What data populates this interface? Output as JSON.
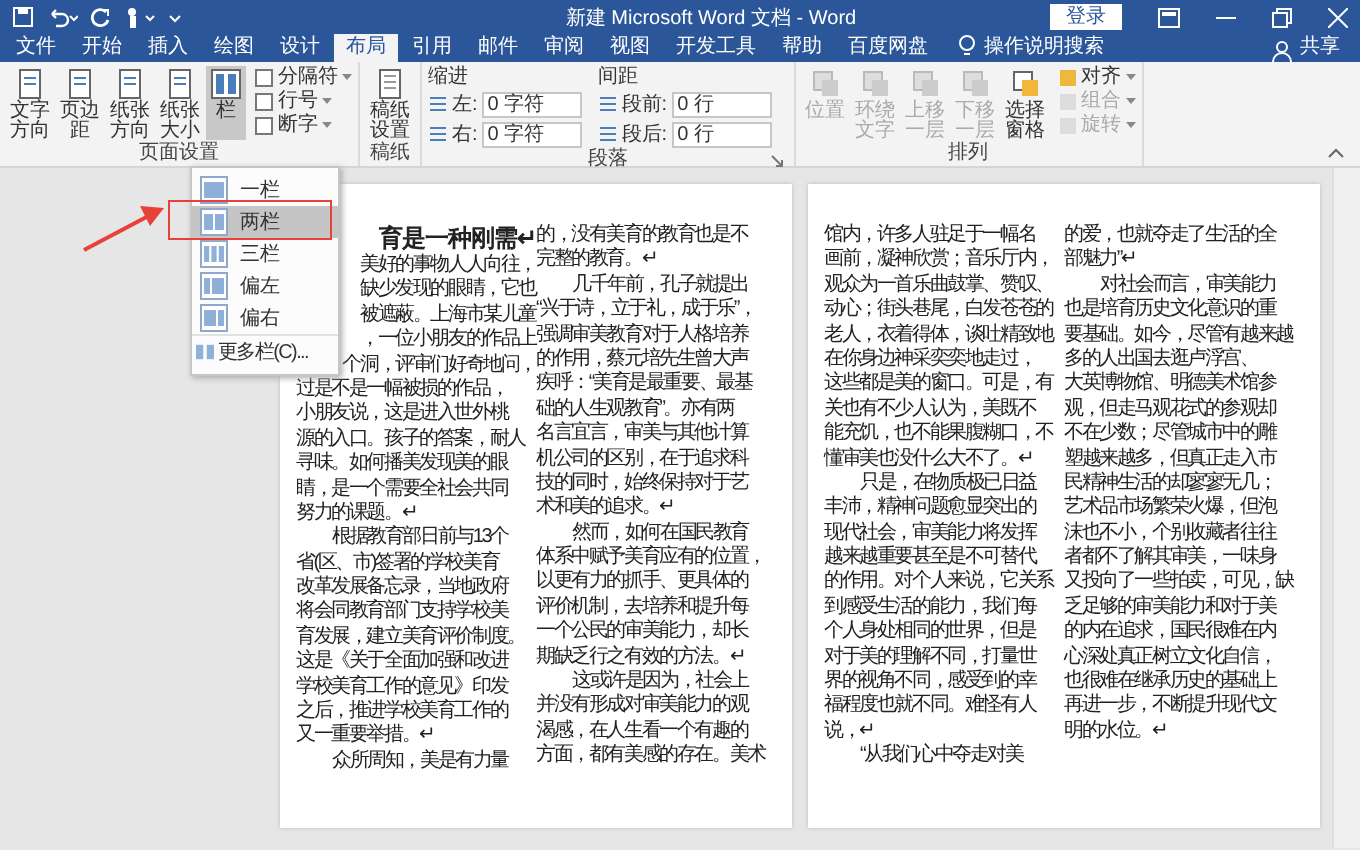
{
  "title_bar": {
    "title": "新建 Microsoft Word 文档 - Word",
    "sign_in": "登录"
  },
  "tabs": [
    {
      "label": "文件",
      "selected": false
    },
    {
      "label": "开始",
      "selected": false
    },
    {
      "label": "插入",
      "selected": false
    },
    {
      "label": "绘图",
      "selected": false
    },
    {
      "label": "设计",
      "selected": false
    },
    {
      "label": "布局",
      "selected": true
    },
    {
      "label": "引用",
      "selected": false
    },
    {
      "label": "邮件",
      "selected": false
    },
    {
      "label": "审阅",
      "selected": false
    },
    {
      "label": "视图",
      "selected": false
    },
    {
      "label": "开发工具",
      "selected": false
    },
    {
      "label": "帮助",
      "selected": false
    },
    {
      "label": "百度网盘",
      "selected": false
    }
  ],
  "tell_me": "操作说明搜索",
  "share": "共享",
  "page_setup": {
    "label": "页面设置",
    "large_buttons": [
      "文字方向",
      "页边距",
      "纸张方向",
      "纸张大小"
    ],
    "columns_button": {
      "label": "栏",
      "pressed": true
    },
    "small_buttons": [
      "分隔符",
      "行号",
      "断字"
    ]
  },
  "draft": {
    "label": "稿纸",
    "button": "稿纸设置"
  },
  "paragraph": {
    "label": "段落",
    "indent": {
      "title": "缩进",
      "fields": [
        {
          "label": "左:",
          "value": "0 字符"
        },
        {
          "label": "右:",
          "value": "0 字符"
        }
      ]
    },
    "spacing": {
      "title": "间距",
      "fields": [
        {
          "label": "段前:",
          "value": "0 行"
        },
        {
          "label": "段后:",
          "value": "0 行"
        }
      ]
    }
  },
  "arrange": {
    "label": "排列",
    "large_buttons": [
      {
        "label": "位置",
        "disabled": true
      },
      {
        "label": "环绕文字",
        "disabled": true
      },
      {
        "label": "上移一层",
        "disabled": true
      },
      {
        "label": "下移一层",
        "disabled": true
      },
      {
        "label": "选择窗格",
        "disabled": false
      }
    ],
    "small_buttons": [
      {
        "label": "对齐",
        "disabled": false
      },
      {
        "label": "组合",
        "disabled": true
      },
      {
        "label": "旋转",
        "disabled": true
      }
    ]
  },
  "columns_menu": {
    "items": [
      {
        "label": "一栏",
        "kind": "one",
        "selected": false
      },
      {
        "label": "两栏",
        "kind": "two",
        "selected": true
      },
      {
        "label": "三栏",
        "kind": "three",
        "selected": false
      },
      {
        "label": "偏左",
        "kind": "left",
        "selected": false
      },
      {
        "label": "偏右",
        "kind": "right",
        "selected": false
      }
    ],
    "more": "更多栏(C)..."
  },
  "pages": [
    {
      "columns": [
        {
          "lines": [
            {
              "text": "育是一种刚需↵",
              "kind": "heading"
            },
            {
              "text": "美好的事物人人向往，",
              "kind": "clipped"
            },
            {
              "text": "缺少发现的眼睛，它也",
              "kind": "clipped"
            },
            {
              "text": "被遮蔽。上海市某儿童",
              "kind": "clipped"
            },
            {
              "text": "，一位小朋友的作品上",
              "kind": "clipped"
            },
            {
              "text": "个洞，评审们好奇地问，",
              "kind": "clipped"
            },
            {
              "text": "过是不是一幅被损的作品，",
              "kind": "body"
            },
            {
              "text": "小朋友说，这是进入世外桃",
              "kind": "body"
            },
            {
              "text": "源的入口。孩子的答案，耐人",
              "kind": "body"
            },
            {
              "text": "寻味。如何播美发现美的眼",
              "kind": "body"
            },
            {
              "text": "睛，是一个需要全社会共同",
              "kind": "body"
            },
            {
              "text": "努力的课题。↵",
              "kind": "last"
            },
            {
              "text": "根据教育部日前与13个",
              "kind": "first"
            },
            {
              "text": "省(区、市)签署的学校美育",
              "kind": "body"
            },
            {
              "text": "改革发展备忘录，当地政府",
              "kind": "body"
            },
            {
              "text": "将会同教育部门支持学校美",
              "kind": "body"
            },
            {
              "text": "育发展，建立美育评价制度。",
              "kind": "body"
            },
            {
              "text": "这是《关于全面加强和改进",
              "kind": "body"
            },
            {
              "text": "学校美育工作的意见》印发",
              "kind": "body"
            },
            {
              "text": "之后，推进学校美育工作的",
              "kind": "body"
            },
            {
              "text": "又一重要举措。↵",
              "kind": "last"
            },
            {
              "text": "众所周知，美是有力量",
              "kind": "first"
            }
          ]
        },
        {
          "lines": [
            {
              "text": "的，没有美育的教育也是不",
              "kind": "body"
            },
            {
              "text": "完整的教育。↵",
              "kind": "last"
            },
            {
              "text": "几千年前，孔子就提出",
              "kind": "first"
            },
            {
              "text": "“兴于诗，立于礼，成于乐”，",
              "kind": "body"
            },
            {
              "text": "强调审美教育对于人格培养",
              "kind": "body"
            },
            {
              "text": "的作用，蔡元培先生曾大声",
              "kind": "body"
            },
            {
              "text": "疾呼：“美育是最重要、最基",
              "kind": "body"
            },
            {
              "text": "础的人生观教育”。亦有两",
              "kind": "body"
            },
            {
              "text": "名言宜言，审美与其他计算",
              "kind": "body"
            },
            {
              "text": "机公司的区别，在于追求科",
              "kind": "body"
            },
            {
              "text": "技的同时，始终保持对于艺",
              "kind": "body"
            },
            {
              "text": "术和美的追求。↵",
              "kind": "last"
            },
            {
              "text": "然而，如何在国民教育",
              "kind": "first"
            },
            {
              "text": "体系中赋予美育应有的位置，",
              "kind": "body"
            },
            {
              "text": "以更有力的抓手、更具体的",
              "kind": "body"
            },
            {
              "text": "评价机制，去培养和提升每",
              "kind": "body"
            },
            {
              "text": "一个公民的审美能力，却长",
              "kind": "body"
            },
            {
              "text": "期缺乏行之有效的方法。↵",
              "kind": "last"
            },
            {
              "text": "这或许是因为，社会上",
              "kind": "first"
            },
            {
              "text": "并没有形成对审美能力的观",
              "kind": "body"
            },
            {
              "text": "渴感，在人生看一个有趣的",
              "kind": "body"
            },
            {
              "text": "方面，都有美感的存在。美术",
              "kind": "body"
            }
          ]
        }
      ]
    },
    {
      "columns": [
        {
          "lines": [
            {
              "text": "馆内，许多人驻足于一幅名",
              "kind": "body"
            },
            {
              "text": "画前，凝神欣赏；音乐厅内，",
              "kind": "body"
            },
            {
              "text": "观众为一首乐曲鼓掌、赞叹、",
              "kind": "body"
            },
            {
              "text": "动心；街头巷尾，白发苍苍的",
              "kind": "body"
            },
            {
              "text": "老人，衣着得体，谈吐精致地",
              "kind": "body"
            },
            {
              "text": "在你身边神采奕奕地走过，",
              "kind": "body"
            },
            {
              "text": "这些都是美的窗口。可是，有",
              "kind": "body"
            },
            {
              "text": "关也有不少人认为，美既不",
              "kind": "body"
            },
            {
              "text": "能充饥，也不能果腹糊口，不",
              "kind": "body"
            },
            {
              "text": "懂审美也没什么大不了。↵",
              "kind": "last"
            },
            {
              "text": "只是，在物质极已日益",
              "kind": "first"
            },
            {
              "text": "丰沛，精神问题愈显突出的",
              "kind": "body"
            },
            {
              "text": "现代社会，审美能力将发挥",
              "kind": "body"
            },
            {
              "text": "越来越重要甚至是不可替代",
              "kind": "body"
            },
            {
              "text": "的作用。对个人来说，它关系",
              "kind": "body"
            },
            {
              "text": "到感受生活的能力，我们每",
              "kind": "body"
            },
            {
              "text": "个人身处相同的世界，但是",
              "kind": "body"
            },
            {
              "text": "对于美的理解不同，打量世",
              "kind": "body"
            },
            {
              "text": "界的视角不同，感受到的幸",
              "kind": "body"
            },
            {
              "text": "福程度也就不同。难怪有人",
              "kind": "body"
            },
            {
              "text": "说，↵",
              "kind": "last"
            },
            {
              "text": "“从我们心中夺走对美",
              "kind": "first"
            }
          ]
        },
        {
          "lines": [
            {
              "text": "的爱，也就夺走了生活的全",
              "kind": "body"
            },
            {
              "text": "部魅力”↵",
              "kind": "last"
            },
            {
              "text": "对社会而言，审美能力",
              "kind": "first"
            },
            {
              "text": "也是培育历史文化意识的重",
              "kind": "body"
            },
            {
              "text": "要基础。如今，尽管有越来越",
              "kind": "body"
            },
            {
              "text": "多的人出国去逛卢浮宫、",
              "kind": "body"
            },
            {
              "text": "大英博物馆、明德美术馆参",
              "kind": "body"
            },
            {
              "text": "观，但走马观花式的参观却",
              "kind": "body"
            },
            {
              "text": "不在少数；尽管城市中的雕",
              "kind": "body"
            },
            {
              "text": "塑越来越多，但真正走入市",
              "kind": "body"
            },
            {
              "text": "民精神生活的却寥寥无几；",
              "kind": "body"
            },
            {
              "text": "艺术品市场繁荣火爆，但泡",
              "kind": "body"
            },
            {
              "text": "沫也不小，个别收藏者往往",
              "kind": "body"
            },
            {
              "text": "者都不了解其审美，一味身",
              "kind": "body"
            },
            {
              "text": "又投向了一些拍卖，可见，缺",
              "kind": "body"
            },
            {
              "text": "乏足够的审美能力和对于美",
              "kind": "body"
            },
            {
              "text": "的内在追求，国民很难在内",
              "kind": "body"
            },
            {
              "text": "心深处真正树立文化自信，",
              "kind": "body"
            },
            {
              "text": "也很难在继承历史的基础上",
              "kind": "body"
            },
            {
              "text": "再进一步，不断提升现代文",
              "kind": "body"
            },
            {
              "text": "明的水位。↵",
              "kind": "last"
            }
          ]
        }
      ]
    }
  ]
}
